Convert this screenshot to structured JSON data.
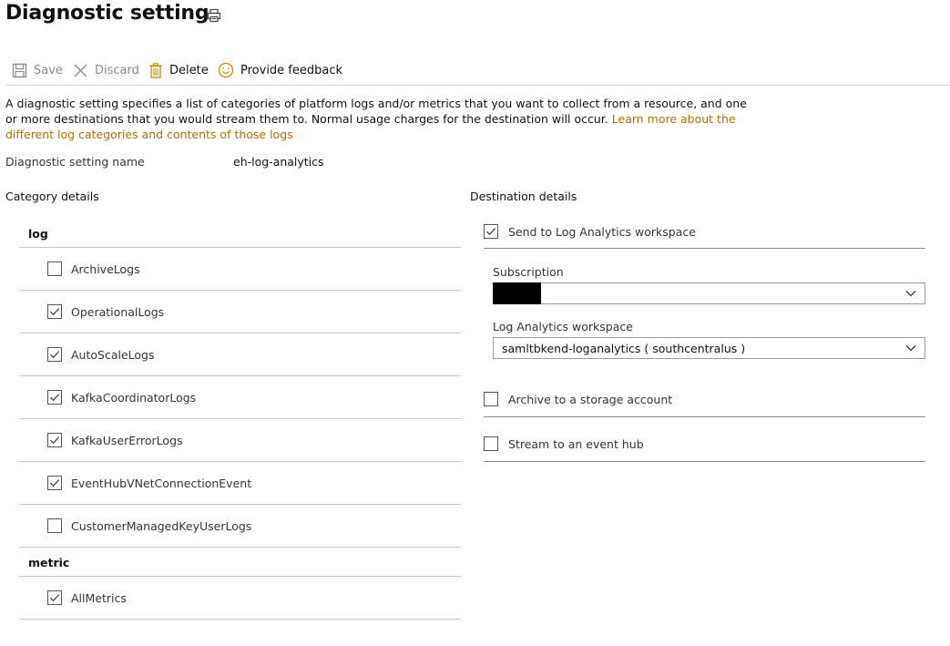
{
  "header": {
    "title": "Diagnostic setting",
    "print_icon": "printer-icon"
  },
  "toolbar": {
    "save_label": "Save",
    "discard_label": "Discard",
    "delete_label": "Delete",
    "feedback_label": "Provide feedback",
    "icons": {
      "save": "floppy-disk-icon",
      "discard": "close-icon",
      "delete": "trash-icon",
      "feedback": "smiley-icon"
    }
  },
  "description": {
    "text": "A diagnostic setting specifies a list of categories of platform logs and/or metrics that you want to collect from a resource, and one or more destinations that you would stream them to. Normal usage charges for the destination will occur.",
    "link_text": "Learn more about the different log categories and contents of those logs"
  },
  "setting_name": {
    "label": "Diagnostic setting name",
    "value": "eh-log-analytics"
  },
  "category_details": {
    "title": "Category details",
    "log_group": "log",
    "logs": [
      {
        "label": "ArchiveLogs",
        "checked": false
      },
      {
        "label": "OperationalLogs",
        "checked": true
      },
      {
        "label": "AutoScaleLogs",
        "checked": true
      },
      {
        "label": "KafkaCoordinatorLogs",
        "checked": true
      },
      {
        "label": "KafkaUserErrorLogs",
        "checked": true
      },
      {
        "label": "EventHubVNetConnectionEvent",
        "checked": true
      },
      {
        "label": "CustomerManagedKeyUserLogs",
        "checked": false
      }
    ],
    "metric_group": "metric",
    "metrics": [
      {
        "label": "AllMetrics",
        "checked": true
      }
    ]
  },
  "destination_details": {
    "title": "Destination details",
    "log_analytics": {
      "label": "Send to Log Analytics workspace",
      "checked": true
    },
    "subscription": {
      "label": "Subscription",
      "value": ""
    },
    "workspace": {
      "label": "Log Analytics workspace",
      "value": "samltbkend-loganalytics ( southcentralus )"
    },
    "storage": {
      "label": "Archive to a storage account",
      "checked": false
    },
    "event_hub": {
      "label": "Stream to an event hub",
      "checked": false
    }
  },
  "colors": {
    "link": "#b07000",
    "disabled_text": "#8a8a8a",
    "divider": "#c8c8c8",
    "feedback_icon": "#d08a00",
    "delete_icon": "#d08a00"
  }
}
